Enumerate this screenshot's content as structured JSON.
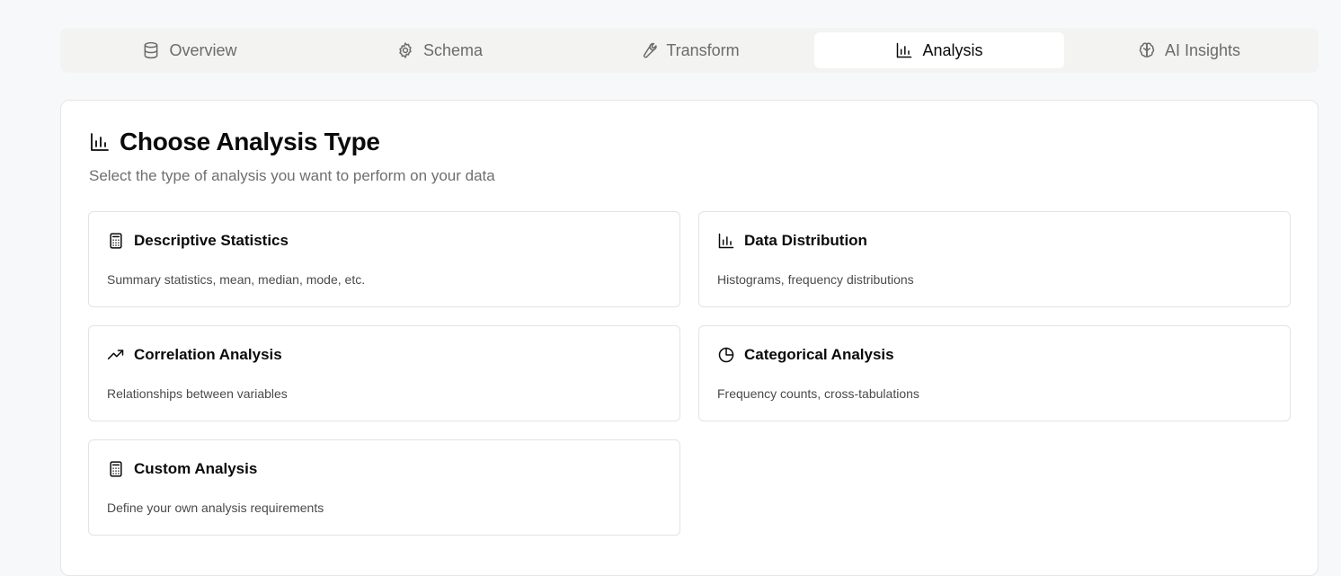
{
  "tabs": [
    {
      "label": "Overview",
      "icon": "database-icon",
      "active": false
    },
    {
      "label": "Schema",
      "icon": "gear-icon",
      "active": false
    },
    {
      "label": "Transform",
      "icon": "wrench-icon",
      "active": false
    },
    {
      "label": "Analysis",
      "icon": "bar-chart-icon",
      "active": true
    },
    {
      "label": "AI Insights",
      "icon": "brain-icon",
      "active": false
    }
  ],
  "panel": {
    "title": "Choose Analysis Type",
    "subtitle": "Select the type of analysis you want to perform on your data",
    "icon": "bar-chart-icon"
  },
  "options": [
    {
      "title": "Descriptive Statistics",
      "description": "Summary statistics, mean, median, mode, etc.",
      "icon": "calculator-icon"
    },
    {
      "title": "Data Distribution",
      "description": "Histograms, frequency distributions",
      "icon": "bar-chart-icon"
    },
    {
      "title": "Correlation Analysis",
      "description": "Relationships between variables",
      "icon": "trending-up-icon"
    },
    {
      "title": "Categorical Analysis",
      "description": "Frequency counts, cross-tabulations",
      "icon": "pie-chart-icon"
    },
    {
      "title": "Custom Analysis",
      "description": "Define your own analysis requirements",
      "icon": "calculator-icon"
    }
  ],
  "colors": {
    "page_bg": "#f7f8fa",
    "tabbar_bg": "#f3f3f1",
    "active_tab_bg": "#ffffff",
    "border": "#e3e3e3",
    "muted_text": "#6f6f6f"
  }
}
